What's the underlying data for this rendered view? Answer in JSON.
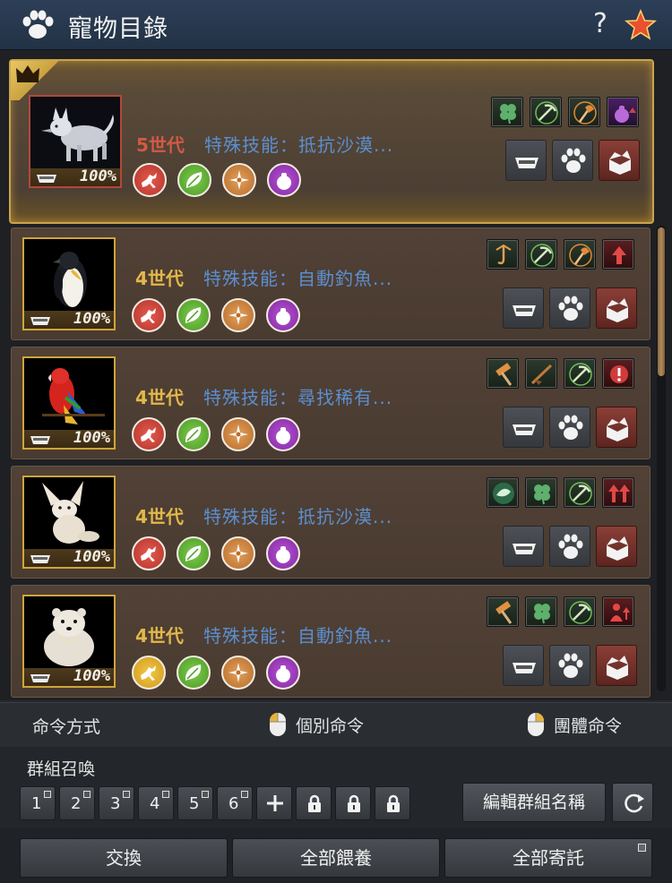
{
  "window": {
    "title": "寵物目錄",
    "help_label": "?"
  },
  "colors": {
    "accent_gold": "#c9a44a",
    "generation_text": "#e3b84a",
    "generation_main": "#d25a46",
    "skill_text": "#5b8fd0"
  },
  "pets": [
    {
      "animal": "arctic-fox",
      "generation": "5世代",
      "skill_text": "特殊技能：抵抗沙漠...",
      "hunger": "100%",
      "traits": [
        "red-run",
        "green-leaf",
        "orange-compass",
        "purple-bag"
      ],
      "skills": [
        "clover",
        "pickaxe",
        "axe",
        "purple-bag"
      ]
    },
    {
      "animal": "penguin",
      "generation": "4世代",
      "skill_text": "特殊技能：自動釣魚...",
      "hunger": "100%",
      "traits": [
        "red-run",
        "green-leaf",
        "orange-compass",
        "purple-bag"
      ],
      "skills": [
        "hook",
        "pickaxe",
        "axe",
        "red-arrow"
      ]
    },
    {
      "animal": "parrot",
      "generation": "4世代",
      "skill_text": "特殊技能：尋找稀有...",
      "hunger": "100%",
      "traits": [
        "red-run",
        "green-leaf",
        "orange-compass",
        "purple-bag"
      ],
      "skills": [
        "hammer",
        "rifle",
        "pickaxe",
        "red-warning"
      ]
    },
    {
      "animal": "fennec-fox",
      "generation": "4世代",
      "skill_text": "特殊技能：抵抗沙漠...",
      "hunger": "100%",
      "traits": [
        "red-run",
        "green-leaf",
        "orange-compass",
        "purple-bag"
      ],
      "skills": [
        "fish",
        "clover",
        "pickaxe",
        "red-arrows"
      ]
    },
    {
      "animal": "polar-bear",
      "generation": "4世代",
      "skill_text": "特殊技能：自動釣魚...",
      "hunger": "100%",
      "traits": [
        "yellow-run",
        "green-leaf",
        "orange-compass",
        "purple-bag"
      ],
      "skills": [
        "hammer",
        "clover",
        "pickaxe",
        "red-person"
      ]
    }
  ],
  "command": {
    "label": "命令方式",
    "individual": "個別命令",
    "group": "團體命令"
  },
  "group_summon": {
    "title": "群組召喚",
    "slots": [
      "1",
      "2",
      "3",
      "4",
      "5",
      "6"
    ],
    "edit_label": "編輯群組名稱"
  },
  "footer": {
    "exchange": "交換",
    "feed_all": "全部餵養",
    "deposit_all": "全部寄託"
  }
}
